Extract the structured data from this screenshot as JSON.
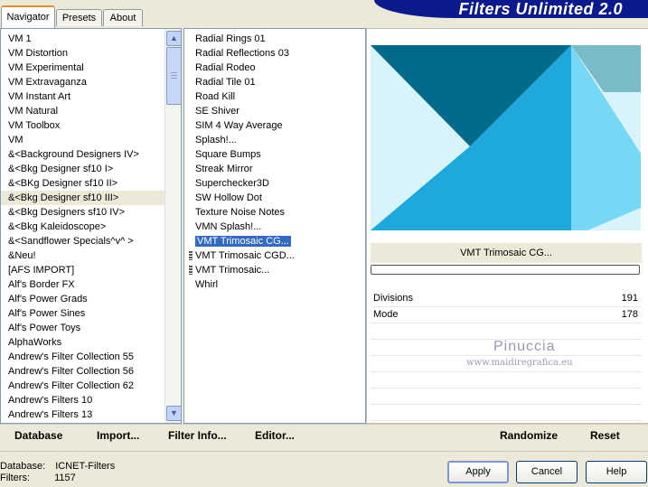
{
  "tabs": [
    "Navigator",
    "Presets",
    "About"
  ],
  "banner": {
    "title": "Filters Unlimited 2.0"
  },
  "categories": [
    "VM 1",
    "VM Distortion",
    "VM Experimental",
    "VM Extravaganza",
    "VM Instant Art",
    "VM Natural",
    "VM Toolbox",
    "VM",
    "&<Background Designers IV>",
    "&<Bkg Designer sf10 I>",
    "&<BKg Designer sf10 II>",
    "&<Bkg Designer sf10 III>",
    "&<Bkg Designers sf10 IV>",
    "&<Bkg Kaleidoscope>",
    "&<Sandflower Specials^v^ >",
    "&Neu!",
    "[AFS IMPORT]",
    "Alf's Border FX",
    "Alf's Power Grads",
    "Alf's Power Sines",
    "Alf's Power Toys",
    "AlphaWorks",
    "Andrew's Filter Collection 55",
    "Andrew's Filter Collection 56",
    "Andrew's Filter Collection 62",
    "Andrew's Filters 10",
    "Andrew's Filters 13"
  ],
  "selected_category": "&<Bkg Designer sf10 III>",
  "filters": [
    "Radial  Rings 01",
    "Radial Reflections 03",
    "Radial Rodeo",
    "Radial Tile 01",
    "Road Kill",
    "SE Shiver",
    "SIM 4 Way Average",
    "Splash!...",
    "Square Bumps",
    "Streak Mirror",
    "Superchecker3D",
    "SW Hollow Dot",
    "Texture Noise Notes",
    "VMN Splash!...",
    "VMT Trimosaic CG...",
    "VMT Trimosaic CGD...",
    "VMT Trimosaic...",
    "Whirl"
  ],
  "selected_filter": "VMT Trimosaic CG...",
  "preview": {
    "filter_name": "VMT Trimosaic CG...",
    "colors": {
      "dark": "#036B8A",
      "mid": "#1DA9DB",
      "light": "#76D8F5",
      "pale": "#D9F3FA",
      "gray": "#79BBC8"
    }
  },
  "params": [
    {
      "label": "Divisions",
      "value": "191"
    },
    {
      "label": "Mode",
      "value": "178"
    }
  ],
  "watermark": {
    "line1": "Pinuccia",
    "line2": "www.maidiregrafica.eu"
  },
  "buttons": {
    "database": "Database",
    "import": "Import...",
    "filter_info": "Filter Info...",
    "editor": "Editor...",
    "randomize": "Randomize",
    "reset": "Reset",
    "apply": "Apply",
    "cancel": "Cancel",
    "help": "Help"
  },
  "status": {
    "database_label": "Database:",
    "database_value": "ICNET-Filters",
    "filters_label": "Filters:",
    "filters_value": "1157"
  }
}
